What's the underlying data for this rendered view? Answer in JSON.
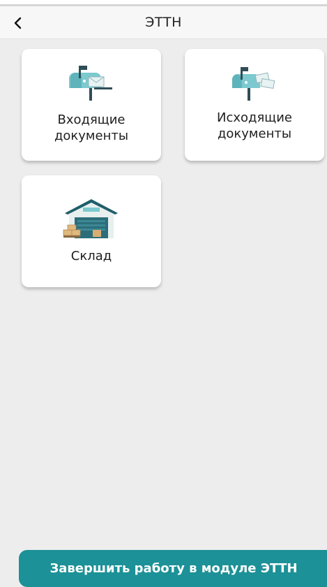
{
  "header": {
    "title": "ЭТТН"
  },
  "tiles": [
    {
      "label": "Входящие\nдокументы",
      "icon": "incoming-mailbox-icon"
    },
    {
      "label": "Исходящие\nдокументы",
      "icon": "outgoing-mailbox-icon"
    },
    {
      "label": "Склад",
      "icon": "warehouse-icon"
    }
  ],
  "footer": {
    "finish_label": "Завершить работу в модуле ЭТТН"
  },
  "colors": {
    "accent": "#1c9197",
    "background": "#ededed",
    "tile_background": "#ffffff"
  }
}
